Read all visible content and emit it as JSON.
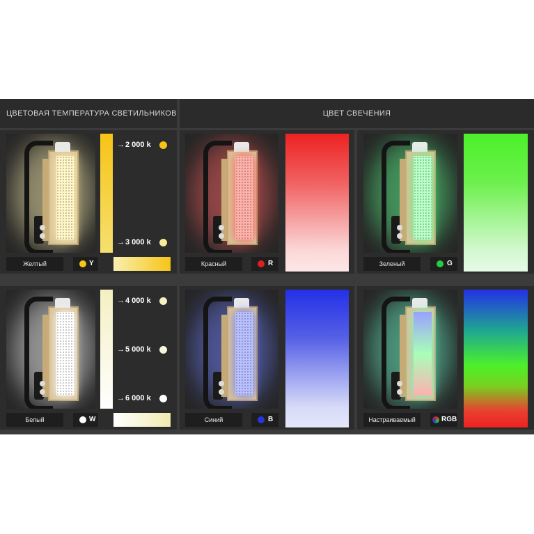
{
  "headers": {
    "left": "ЦВЕТОВАЯ ТЕМПЕРАТУРА СВЕТИЛЬНИКОВ",
    "right": "ЦВЕТ СВЕЧЕНИЯ"
  },
  "cards": [
    {
      "label": "Желтый",
      "code": "Y",
      "dot_color": "#f5c518",
      "glow": "#fff3b0",
      "diffuser": "#fff6c8"
    },
    {
      "label": "Красный",
      "code": "R",
      "dot_color": "#e02020",
      "glow": "#ff5a5a",
      "diffuser": "#ffb0a8"
    },
    {
      "label": "Зеленый",
      "code": "G",
      "dot_color": "#22cc44",
      "glow": "#55ff88",
      "diffuser": "#b8ffc8"
    },
    {
      "label": "Белый",
      "code": "W",
      "dot_color": "#ffffff",
      "glow": "#ffffff",
      "diffuser": "#ffffff"
    },
    {
      "label": "Синий",
      "code": "B",
      "dot_color": "#2a34d8",
      "glow": "#6a7aff",
      "diffuser": "#b8c0ff"
    },
    {
      "label": "Настраиваемый",
      "code": "RGB",
      "dot_color": "rgb",
      "glow": "#66ffcc",
      "diffuser": "#c8ffd8"
    }
  ],
  "temps_top": [
    "2 000 k",
    "3 000 k"
  ],
  "temps_bottom": [
    "4 000 k",
    "5 000 k",
    "6 000 k"
  ],
  "colors": {
    "yellow_bar": "#f7c417",
    "temp2000": "#f7c417",
    "temp3000": "#f5ec9a",
    "temp4000": "#f4f0c2",
    "temp5000": "#f8f6d8",
    "temp6000": "#ffffff",
    "red": "#ee2222",
    "green": "#4cf02a",
    "blue": "#2430e6"
  }
}
